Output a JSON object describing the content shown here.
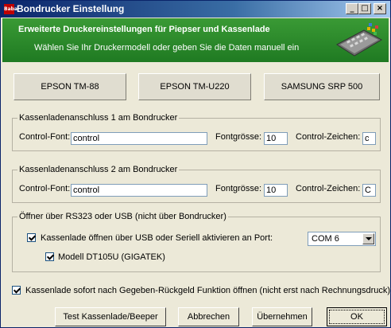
{
  "window": {
    "title": "Bondrucker Einstellung",
    "icon_text": "Baba"
  },
  "titlebar_buttons": {
    "minimize": "_",
    "maximize": "□",
    "close": "×"
  },
  "banner": {
    "title": "Erweiterte Druckereinstellungen für Piepser und Kassenlade",
    "subtitle": "Wählen Sie Ihr Druckermodell oder geben Sie die Daten manuell ein",
    "image_icon": "cash-register-keyboard-icon"
  },
  "presets": [
    "EPSON TM-88",
    "EPSON TM-U220",
    "SAMSUNG SRP 500"
  ],
  "group1": {
    "legend": "Kassenladenanschluss 1 am Bondrucker",
    "control_font_label": "Control-Font:",
    "control_font_value": "control",
    "fontsize_label": "Fontgrösse:",
    "fontsize_value": "10",
    "control_char_label": "Control-Zeichen:",
    "control_char_value": "c"
  },
  "group2": {
    "legend": "Kassenladenanschluss 2 am Bondrucker",
    "control_font_label": "Control-Font:",
    "control_font_value": "control",
    "fontsize_label": "Fontgrösse:",
    "fontsize_value": "10",
    "control_char_label": "Control-Zeichen:",
    "control_char_value": "C"
  },
  "group3": {
    "legend": "Öffner über RS323 oder USB (nicht über Bondrucker)",
    "usb_checkbox_label": "Kassenlade öffnen über USB oder Seriell aktivieren an Port:",
    "usb_checked": true,
    "port_value": "COM 6",
    "model_checkbox_label": "Modell DT105U (GIGATEK)",
    "model_checked": true
  },
  "open_after_change": {
    "label": "Kassenlade sofort nach Gegeben-Rückgeld Funktion öffnen (nicht erst nach Rechnungsdruck)",
    "checked": true
  },
  "buttons": {
    "test": "Test Kassenlade/Beeper",
    "cancel": "Abbrechen",
    "apply": "Übernehmen",
    "ok": "OK"
  },
  "colors": {
    "banner_green": "#2e8b2e",
    "titlebar_blue": "#0a246a"
  }
}
